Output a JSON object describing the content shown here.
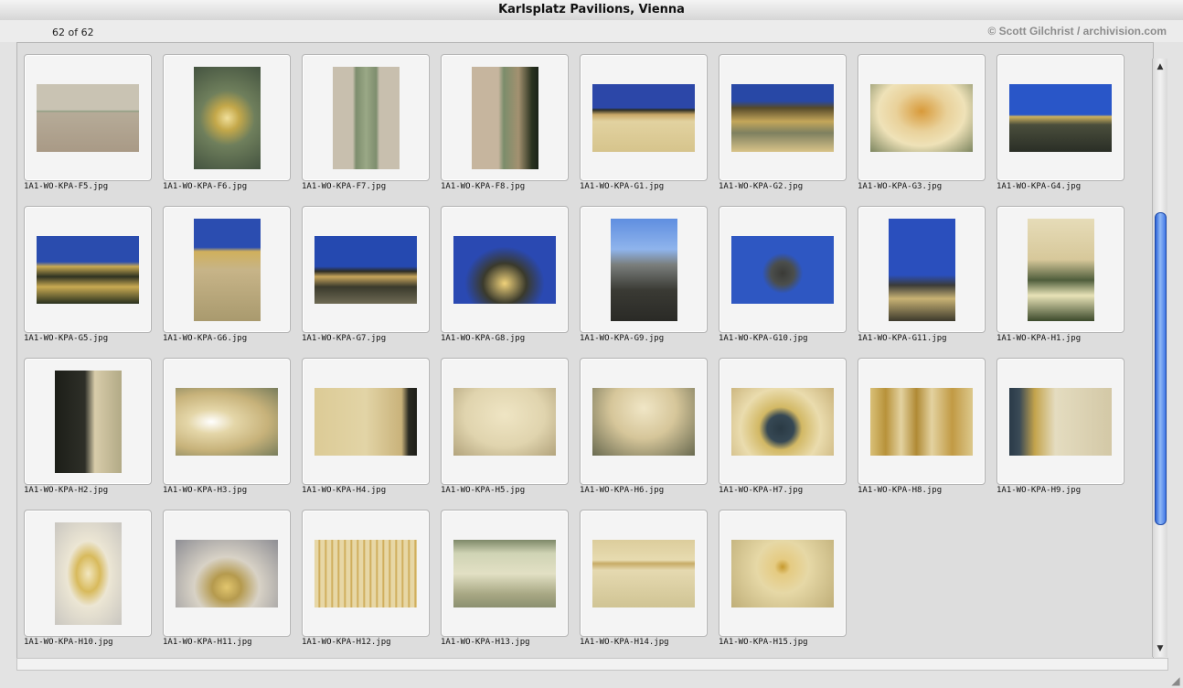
{
  "window": {
    "title": "Karlsplatz Pavilions, Vienna"
  },
  "info": {
    "count": "62 of 62",
    "copyright": "© Scott Gilchrist / archivision.com"
  },
  "scroll": {
    "position": 0.54
  },
  "thumbnails": [
    {
      "label": "1A1-WO-KPA-F5.jpg",
      "orient": "l",
      "bg": "linear-gradient(#c9c3b3 0%, #c9c3b3 38%, #8e9c82 40%, #b6ab98 42%, #a99a86 100%)"
    },
    {
      "label": "1A1-WO-KPA-F6.jpg",
      "orient": "p",
      "bg": "radial-gradient(circle at 50% 50%, #f0df9a 0%, #c4a84a 20%, #6f7f5c 45%, #445340 100%)"
    },
    {
      "label": "1A1-WO-KPA-F7.jpg",
      "orient": "p",
      "bg": "linear-gradient(90deg, #c8bfae 0%, #c8bfae 30%, #7d8d6d 35%, #9aa886 50%, #7d8d6d 65%, #c8bfae 70%, #c8bfae 100%)"
    },
    {
      "label": "1A1-WO-KPA-F8.jpg",
      "orient": "p",
      "bg": "linear-gradient(90deg, #c6b59e 0%, #c6b59e 40%, #7b8d6b 48%, #a39170 70%, #2a3320 90%, #1a2218 100%)"
    },
    {
      "label": "1A1-WO-KPA-G1.jpg",
      "orient": "l",
      "bg": "linear-gradient(#2c47a8 0%, #2c47a8 35%, #2a2c24 38%, #c8a866 45%, #e2d2a0 55%, #d6c48c 100%)"
    },
    {
      "label": "1A1-WO-KPA-G2.jpg",
      "orient": "l",
      "bg": "linear-gradient(#2848a6 0%, #2848a6 25%, #564a2a 35%, #c4a65a 55%, #7e8060 72%, #d8c388 100%)"
    },
    {
      "label": "1A1-WO-KPA-G3.jpg",
      "orient": "l",
      "bg": "radial-gradient(ellipse at 50% 40%, #d89a3a 0%, #e9d19a 35%, #efe2b8 60%, #7d8660 100%)"
    },
    {
      "label": "1A1-WO-KPA-G4.jpg",
      "orient": "l",
      "bg": "linear-gradient(#2956c8 0%, #2956c8 45%, #d0b25e 48%, #4a4e3c 60%, #2a2e26 100%)"
    },
    {
      "label": "1A1-WO-KPA-G5.jpg",
      "orient": "l",
      "bg": "linear-gradient(#2a4cae 0%, #2a4cae 38%, #c9aa52 45%, #2e3222 60%, #c9aa52 75%, #28301e 100%)"
    },
    {
      "label": "1A1-WO-KPA-G6.jpg",
      "orient": "p",
      "bg": "linear-gradient(#2b4db0 0%, #2b4db0 28%, #d0b05c 32%, #c7b488 50%, #a99a6e 100%)"
    },
    {
      "label": "1A1-WO-KPA-G7.jpg",
      "orient": "l",
      "bg": "linear-gradient(#2549b0 0%, #2549b0 45%, #2c2c24 52%, #c8a65c 60%, #3a3a2c 75%, #6e6a54 100%)"
    },
    {
      "label": "1A1-WO-KPA-G8.jpg",
      "orient": "l",
      "bg": "radial-gradient(ellipse at 50% 70%, #f0d27a 0%, #3a3a2c 30%, #2a49b2 55%, #2a49b2 100%)"
    },
    {
      "label": "1A1-WO-KPA-G9.jpg",
      "orient": "p",
      "bg": "linear-gradient(#5f8ee0 0%, #8fb4ec 30%, #7a7e7c 45%, #3a3a34 70%, #2a2a26 100%)"
    },
    {
      "label": "1A1-WO-KPA-G10.jpg",
      "orient": "l",
      "bg": "radial-gradient(circle at 50% 55%, #3a3a36 0%, #4b4e4c 18%, #2e57c2 32%, #2e57c2 100%)"
    },
    {
      "label": "1A1-WO-KPA-G11.jpg",
      "orient": "p",
      "bg": "linear-gradient(#2a4fbd 0%, #2a4fbd 55%, #3b3c38 65%, #c8b274 78%, #3d3a2c 100%)"
    },
    {
      "label": "1A1-WO-KPA-H1.jpg",
      "orient": "p",
      "bg": "linear-gradient(#e6dcb8 0%, #d7c89a 40%, #4f5e3c 60%, #e8e3b8 75%, #3c4a2c 100%)"
    },
    {
      "label": "1A1-WO-KPA-H2.jpg",
      "orient": "p",
      "bg": "linear-gradient(90deg, #1c1e18 0%, #2e2f28 45%, #d8ccaa 60%, #b2aa86 100%)"
    },
    {
      "label": "1A1-WO-KPA-H3.jpg",
      "orient": "l",
      "bg": "radial-gradient(ellipse at 35% 50%, #ffffff 0%, #e4d6a8 25%, #c7b27a 60%, #787d5c 100%)"
    },
    {
      "label": "1A1-WO-KPA-H4.jpg",
      "orient": "l",
      "bg": "linear-gradient(90deg, #dccb96 0%, #e2d4a6 50%, #c9b27a 85%, #2a2a22 92%, #1e1e18 100%)"
    },
    {
      "label": "1A1-WO-KPA-H5.jpg",
      "orient": "l",
      "bg": "radial-gradient(ellipse at 50% 40%, #efe5c4 0%, #e0d4ae 55%, #b2a37c 100%)"
    },
    {
      "label": "1A1-WO-KPA-H6.jpg",
      "orient": "l",
      "bg": "radial-gradient(ellipse at 50% 30%, #f0e6c6 0%, #d6c69a 45%, #696a50 100%)"
    },
    {
      "label": "1A1-WO-KPA-H7.jpg",
      "orient": "l",
      "bg": "radial-gradient(circle at 48% 60%, #2a3a44 0%, #364854 20%, #d2b864 32%, #eadcae 60%, #c9b27a 100%)"
    },
    {
      "label": "1A1-WO-KPA-H8.jpg",
      "orient": "l",
      "bg": "linear-gradient(90deg, #d9c078 0%, #b8923a 15%, #e3d2a0 30%, #b08a34 45%, #e3d2a0 60%, #c19a44 80%, #dcc88c 100%)"
    },
    {
      "label": "1A1-WO-KPA-H9.jpg",
      "orient": "l",
      "bg": "linear-gradient(90deg, #2a3a48 0%, #3a4a56 10%, #c4a44c 25%, #e4dcc0 45%, #d3c8a6 100%)"
    },
    {
      "label": "1A1-WO-KPA-H10.jpg",
      "orient": "p",
      "bg": "radial-gradient(ellipse at 50% 50%, #f2e7c0 0%, #d8ba5c 25%, #ece6d4 45%, #c9c6c0 100%)"
    },
    {
      "label": "1A1-WO-KPA-H11.jpg",
      "orient": "l",
      "bg": "radial-gradient(ellipse at 50% 70%, #e2c66e 0%, #b59a4e 20%, #d8d2c6 45%, #8e8e94 100%)"
    },
    {
      "label": "1A1-WO-KPA-H12.jpg",
      "orient": "l",
      "bg": "repeating-linear-gradient(90deg, #e7d7a6 0px, #e7d7a6 4px, #c8a246 5px, #e7d7a6 7px)"
    },
    {
      "label": "1A1-WO-KPA-H13.jpg",
      "orient": "l",
      "bg": "linear-gradient(#7e8868 0%, #cfd3b4 20%, #e2e0c4 50%, #a8a884 80%, #8c9070 100%)"
    },
    {
      "label": "1A1-WO-KPA-H14.jpg",
      "orient": "l",
      "bg": "linear-gradient(#dccd9c 0%, #e7dbb0 30%, #c7ab66 35%, #e5d9b0 45%, #d0c494 100%)"
    },
    {
      "label": "1A1-WO-KPA-H15.jpg",
      "orient": "l",
      "bg": "radial-gradient(circle at 50% 40%, #c69a2e 0%, #e5cb82 12%, #e6d8a6 40%, #bfae78 100%)"
    }
  ]
}
